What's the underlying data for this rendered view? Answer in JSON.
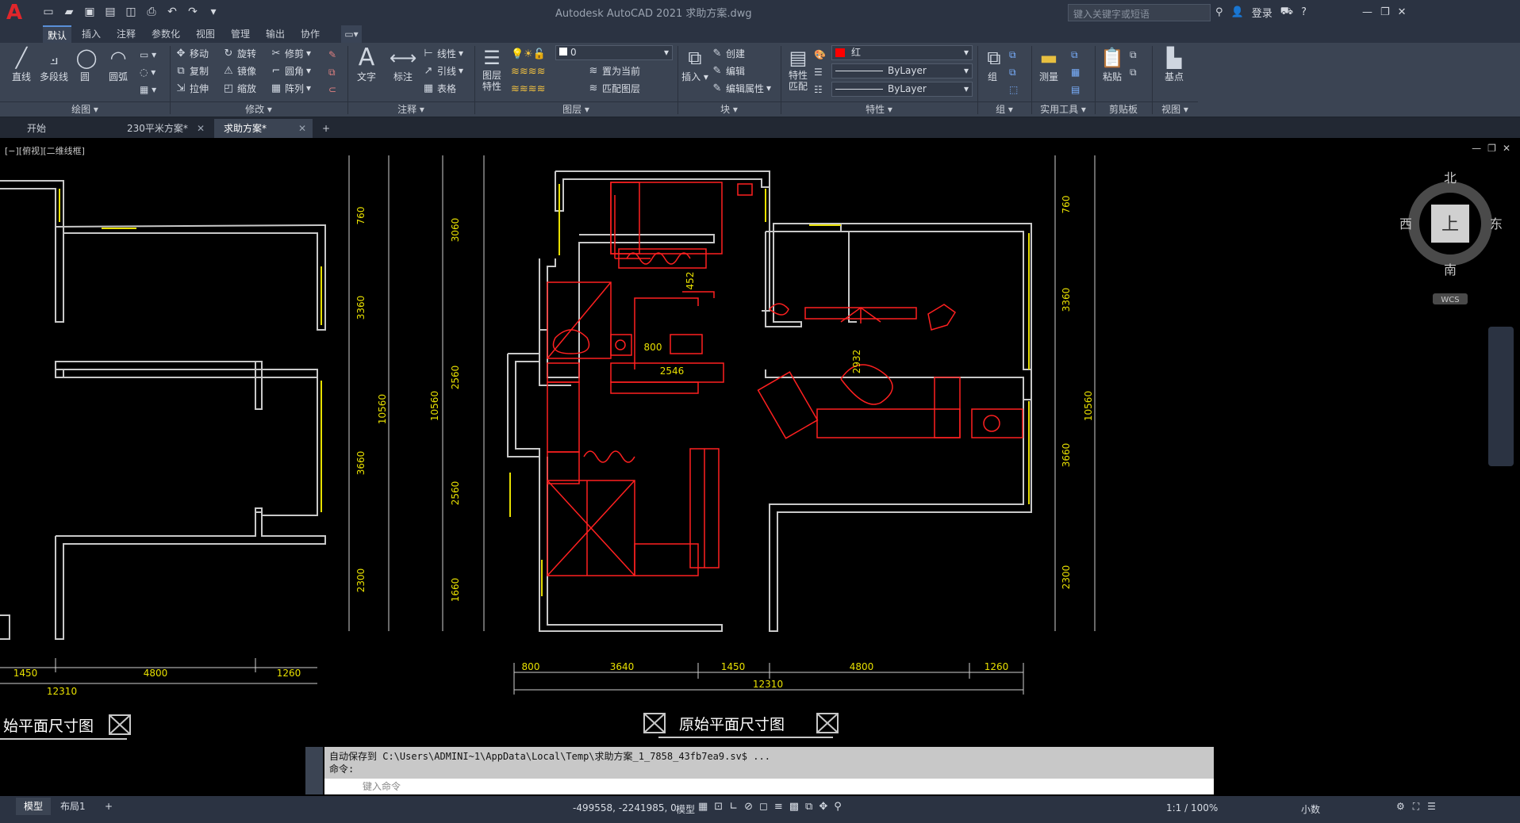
{
  "app": {
    "title": "Autodesk AutoCAD 2021    求助方案.dwg",
    "search_placeholder": "键入关键字或短语",
    "login": "登录",
    "logo": "A"
  },
  "qat_icons": [
    "new-icon",
    "open-icon",
    "save-icon",
    "saveas-icon",
    "web-icon",
    "print-icon",
    "undo-icon",
    "redo-icon",
    "dropdown-icon"
  ],
  "menu": {
    "tabs": [
      "默认",
      "插入",
      "注释",
      "参数化",
      "视图",
      "管理",
      "输出",
      "协作"
    ]
  },
  "ribbon": {
    "draw": {
      "line": "直线",
      "pline": "多段线",
      "circle": "圆",
      "arc": "圆弧",
      "label": "绘图 ▾"
    },
    "modify": {
      "move": "移动",
      "rotate": "旋转",
      "trim": "修剪",
      "copy": "复制",
      "mirror": "镜像",
      "fillet": "圆角",
      "stretch": "拉伸",
      "scale": "缩放",
      "array": "阵列",
      "label": "修改 ▾"
    },
    "annotation": {
      "text": "文字",
      "dim": "标注",
      "linear": "线性",
      "leader": "引线",
      "table": "表格",
      "label": "注释 ▾"
    },
    "layers": {
      "props": "图层\n特性",
      "current_layer": "0",
      "set_current": "置为当前",
      "match": "匹配图层",
      "label": "图层 ▾"
    },
    "block": {
      "insert": "插入",
      "create": "创建",
      "edit": "编辑",
      "edit_attr": "编辑属性",
      "label": "块 ▾"
    },
    "properties": {
      "match": "特性\n匹配",
      "color": "红",
      "linetype": "ByLayer",
      "lineweight": "ByLayer",
      "label": "特性 ▾"
    },
    "groups": {
      "group": "组",
      "label": "组 ▾"
    },
    "utilities": {
      "measure": "测量",
      "label": "实用工具 ▾"
    },
    "clipboard": {
      "paste": "粘贴",
      "label": "剪贴板"
    },
    "view": {
      "base": "基点",
      "label": "视图 ▾"
    }
  },
  "doctabs": [
    "开始",
    "230平米方案*",
    "求助方案*"
  ],
  "viewport": {
    "label": "[−][俯视][二维线框]",
    "compass": {
      "north": "北",
      "south": "南",
      "east": "东",
      "west": "西",
      "top": "上",
      "wcs": "WCS"
    }
  },
  "drawing": {
    "dims_left_plan": [
      "1450",
      "4800",
      "1260",
      "12310"
    ],
    "dims_main_top": [
      "800",
      "3640",
      "1450",
      "4800",
      "1260",
      "12310"
    ],
    "dims_vertical_left": [
      "3060",
      "2560",
      "2560",
      "1660",
      "10560"
    ],
    "dims_vertical_right": [
      "760",
      "3360",
      "3660",
      "2300",
      "10560"
    ],
    "dims_vertical_leftplan": [
      "760",
      "3360",
      "3660",
      "2300",
      "10560"
    ],
    "interior": [
      "2546",
      "2932",
      "800",
      "452"
    ],
    "title_main": "原始平面尺寸图",
    "title_left": "始平面尺寸图"
  },
  "command": {
    "history": "自动保存到  C:\\Users\\ADMINI~1\\AppData\\Local\\Temp\\求助方案_1_7858_43fb7ea9.sv$ ...",
    "prompt": "命令:",
    "placeholder": "键入命令"
  },
  "status": {
    "model_tab": "模型",
    "layout1": "布局1",
    "plus": "+",
    "coords": "-499558, -2241985, 0",
    "model": "模型",
    "scale": "1:1 / 100%",
    "units": "小数"
  }
}
